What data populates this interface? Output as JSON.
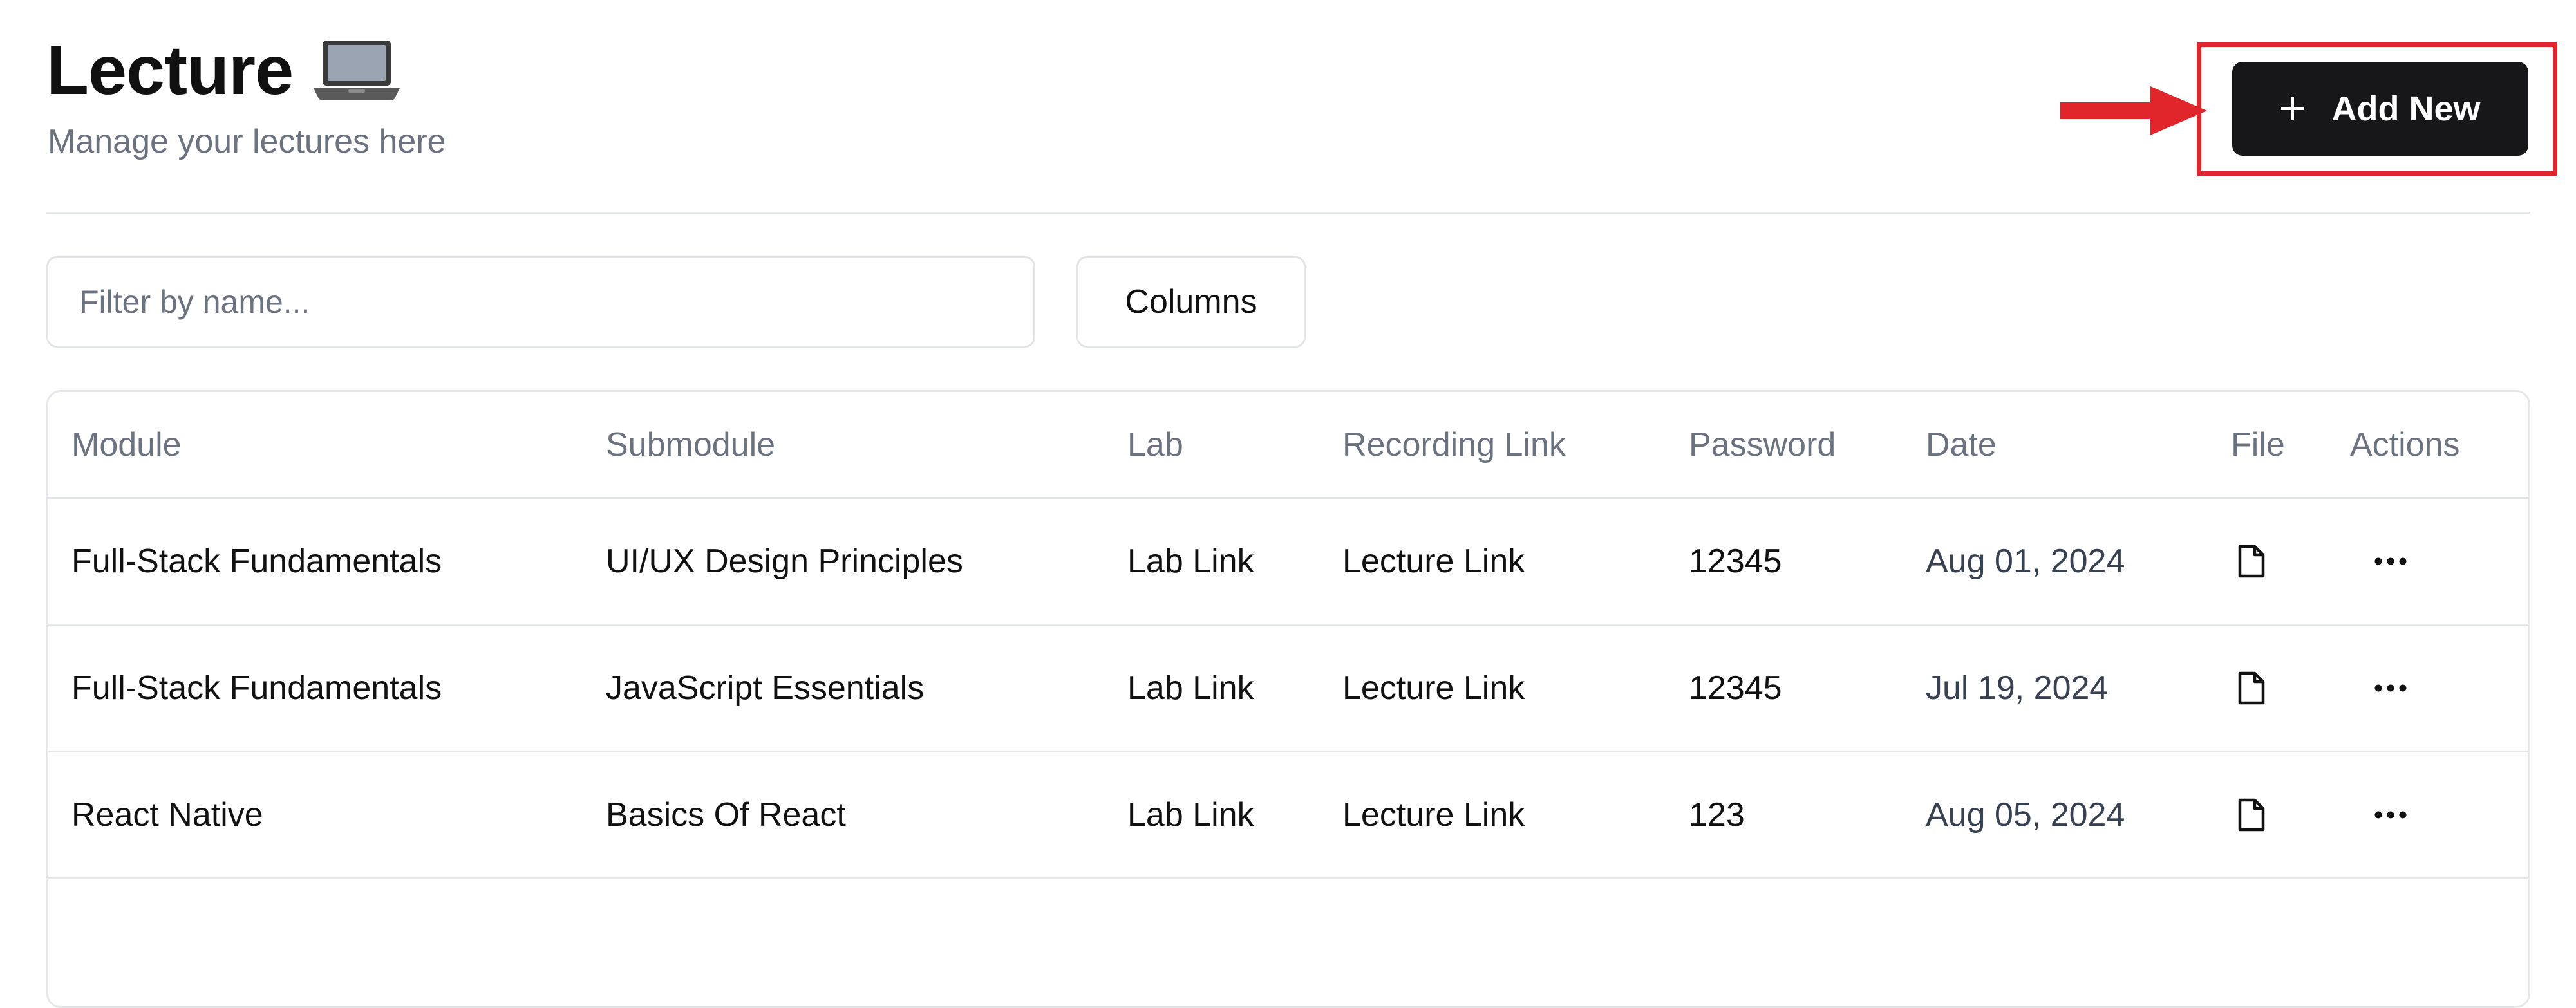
{
  "header": {
    "title": "Lecture",
    "title_icon": "laptop-icon",
    "subtitle": "Manage your lectures here"
  },
  "toolbar": {
    "add_button_label": "Add New",
    "add_button_icon": "plus-icon",
    "filter_placeholder": "Filter by name...",
    "filter_value": "",
    "columns_label": "Columns"
  },
  "annotation": {
    "arrow_color": "#e0262b",
    "highlight_color": "#e0262b"
  },
  "table": {
    "columns": {
      "module": "Module",
      "submodule": "Submodule",
      "lab": "Lab",
      "recording": "Recording Link",
      "password": "Password",
      "date": "Date",
      "file": "File",
      "actions": "Actions"
    },
    "rows": [
      {
        "module": "Full-Stack Fundamentals",
        "submodule": "UI/UX Design Principles",
        "lab": "Lab Link",
        "recording": "Lecture Link",
        "password": "12345",
        "date": "Aug 01, 2024",
        "file_icon": "file-icon",
        "actions_icon": "more-horizontal-icon"
      },
      {
        "module": "Full-Stack Fundamentals",
        "submodule": "JavaScript Essentials",
        "lab": "Lab Link",
        "recording": "Lecture Link",
        "password": "12345",
        "date": "Jul 19, 2024",
        "file_icon": "file-icon",
        "actions_icon": "more-horizontal-icon"
      },
      {
        "module": "React Native",
        "submodule": "Basics Of React",
        "lab": "Lab Link",
        "recording": "Lecture Link",
        "password": "123",
        "date": "Aug 05, 2024",
        "file_icon": "file-icon",
        "actions_icon": "more-horizontal-icon"
      }
    ]
  }
}
